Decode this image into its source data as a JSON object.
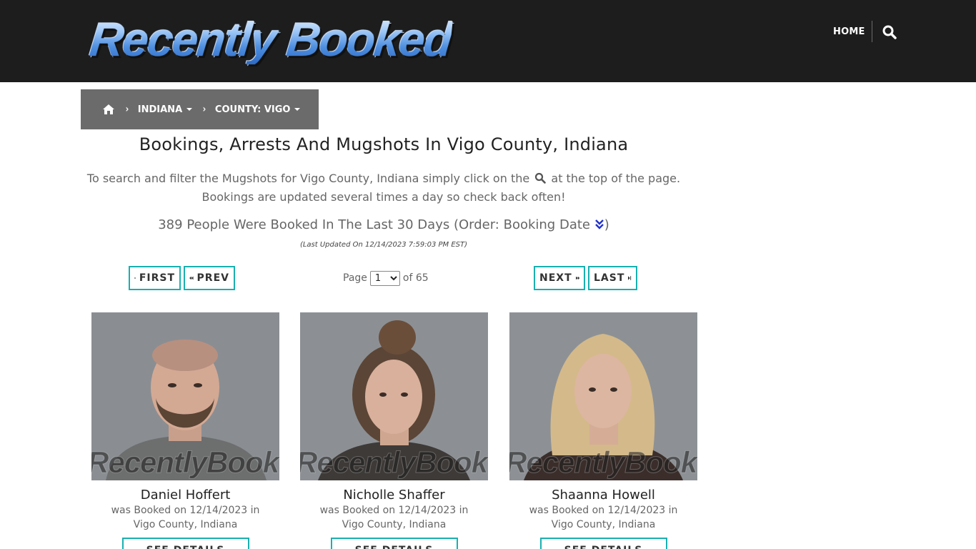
{
  "header": {
    "logo_text": "Recently Booked",
    "nav_home": "HOME",
    "search_icon": "search-icon"
  },
  "breadcrumb": {
    "home_icon": "home-icon",
    "items": [
      {
        "label": "INDIANA"
      },
      {
        "label": "COUNTY: VIGO"
      }
    ]
  },
  "main": {
    "title": "Bookings, Arrests And Mugshots In Vigo County, Indiana",
    "intro_before": "To search and filter the Mugshots for Vigo County, Indiana simply click on the",
    "intro_after": "at the top of the page. Bookings are updated several times a day so check back often!",
    "count_text": "389 People Were Booked In The Last 30 Days (Order: Booking Date",
    "count_close": ")",
    "last_updated": "(Last Updated On 12/14/2023 7:59:03 PM EST)"
  },
  "pagination": {
    "first": "FIRST",
    "prev": "PREV",
    "next": "NEXT",
    "last": "LAST",
    "page_label": "Page",
    "current_page": "1",
    "of_label": "of 65"
  },
  "watermark": "RecentlyBooked.com",
  "people": [
    {
      "name": "Daniel Hoffert",
      "booked_line1": "was Booked on 12/14/2023 in",
      "booked_line2": "Vigo County, Indiana",
      "details": "SEE DETAILS"
    },
    {
      "name": "Nicholle Shaffer",
      "booked_line1": "was Booked on 12/14/2023 in",
      "booked_line2": "Vigo County, Indiana",
      "details": "SEE DETAILS"
    },
    {
      "name": "Shaanna Howell",
      "booked_line1": "was Booked on 12/14/2023 in",
      "booked_line2": "Vigo County, Indiana",
      "details": "SEE DETAILS"
    }
  ],
  "colors": {
    "header_bg": "#1d1d1d",
    "breadcrumb_bg": "#6b6b6b",
    "accent_teal": "#1ab0b0",
    "order_icon": "#2233cc"
  }
}
